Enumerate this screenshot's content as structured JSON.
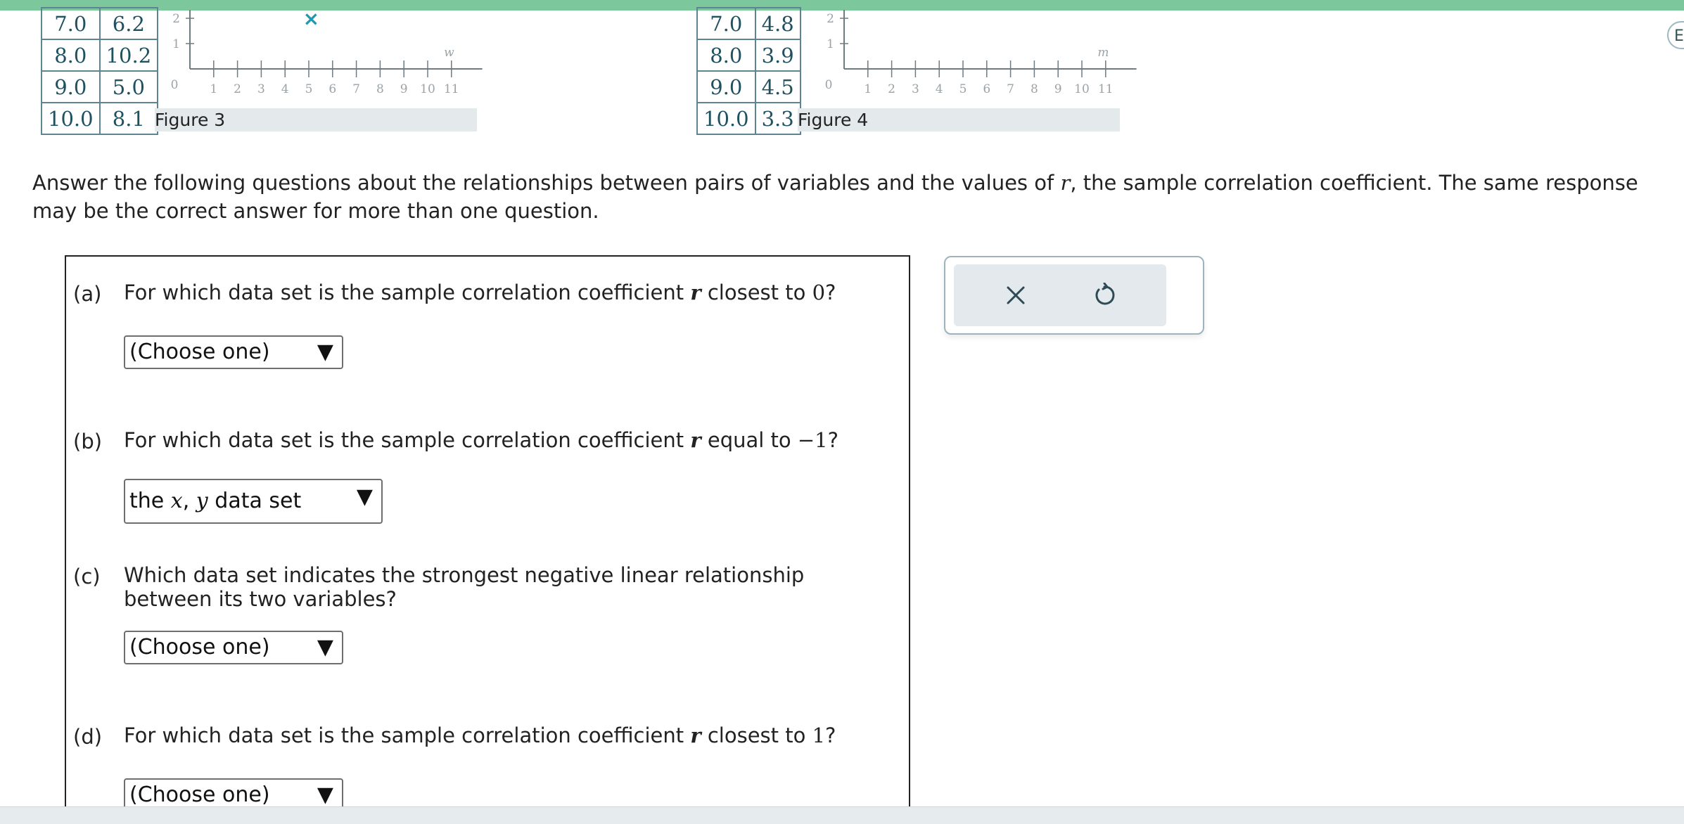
{
  "figure3": {
    "table_rows": [
      [
        "7.0",
        "6.2"
      ],
      [
        "8.0",
        "10.2"
      ],
      [
        "9.0",
        "5.0"
      ],
      [
        "10.0",
        "8.1"
      ]
    ],
    "caption": "Figure 3",
    "axis_var": "w",
    "y_ticks": [
      "2",
      "1"
    ],
    "x_ticks": [
      "0",
      "1",
      "2",
      "3",
      "4",
      "5",
      "6",
      "7",
      "8",
      "9",
      "10",
      "11"
    ],
    "visible_point_symbol": "×"
  },
  "figure4": {
    "table_rows": [
      [
        "7.0",
        "4.8"
      ],
      [
        "8.0",
        "3.9"
      ],
      [
        "9.0",
        "4.5"
      ],
      [
        "10.0",
        "3.3"
      ]
    ],
    "caption": "Figure 4",
    "axis_var": "m",
    "y_ticks": [
      "2",
      "1"
    ],
    "x_ticks": [
      "0",
      "1",
      "2",
      "3",
      "4",
      "5",
      "6",
      "7",
      "8",
      "9",
      "10",
      "11"
    ]
  },
  "intro": {
    "before": "Answer the following questions about the relationships between pairs of variables and the values of ",
    "var": "r",
    "after": ", the sample correlation coefficient. The same response may be the correct answer for more than one question."
  },
  "questions": [
    {
      "label": "(a)",
      "text_pre": "For which data set is the sample correlation coefficient ",
      "r": "r",
      "text_post": " closest to ",
      "value": "0",
      "end": "?",
      "select_value": "(Choose one)"
    },
    {
      "label": "(b)",
      "text_pre": "For which data set is the sample correlation coefficient ",
      "r": "r",
      "text_post": " equal to ",
      "value": "−1",
      "end": "?",
      "select_pre": "the ",
      "select_x": "x",
      "select_comma": ", ",
      "select_y": "y",
      "select_post": " data set"
    },
    {
      "label": "(c)",
      "text": "Which data set indicates the strongest negative linear relationship between its two variables?",
      "select_value": "(Choose one)"
    },
    {
      "label": "(d)",
      "text_pre": "For which data set is the sample correlation coefficient ",
      "r": "r",
      "text_post": " closest to ",
      "value": "1",
      "end": "?",
      "select_value": "(Choose one)"
    }
  ],
  "toolbar": {
    "icons": [
      "close-icon",
      "undo-icon"
    ]
  },
  "edge_button": {
    "label": "E"
  },
  "colors": {
    "topbar": "#7dc79d",
    "table_text": "#1f5160",
    "point_marker": "#1a9bb0",
    "panel_bg": "#e3e9ec"
  },
  "arrow_glyph": "▼"
}
